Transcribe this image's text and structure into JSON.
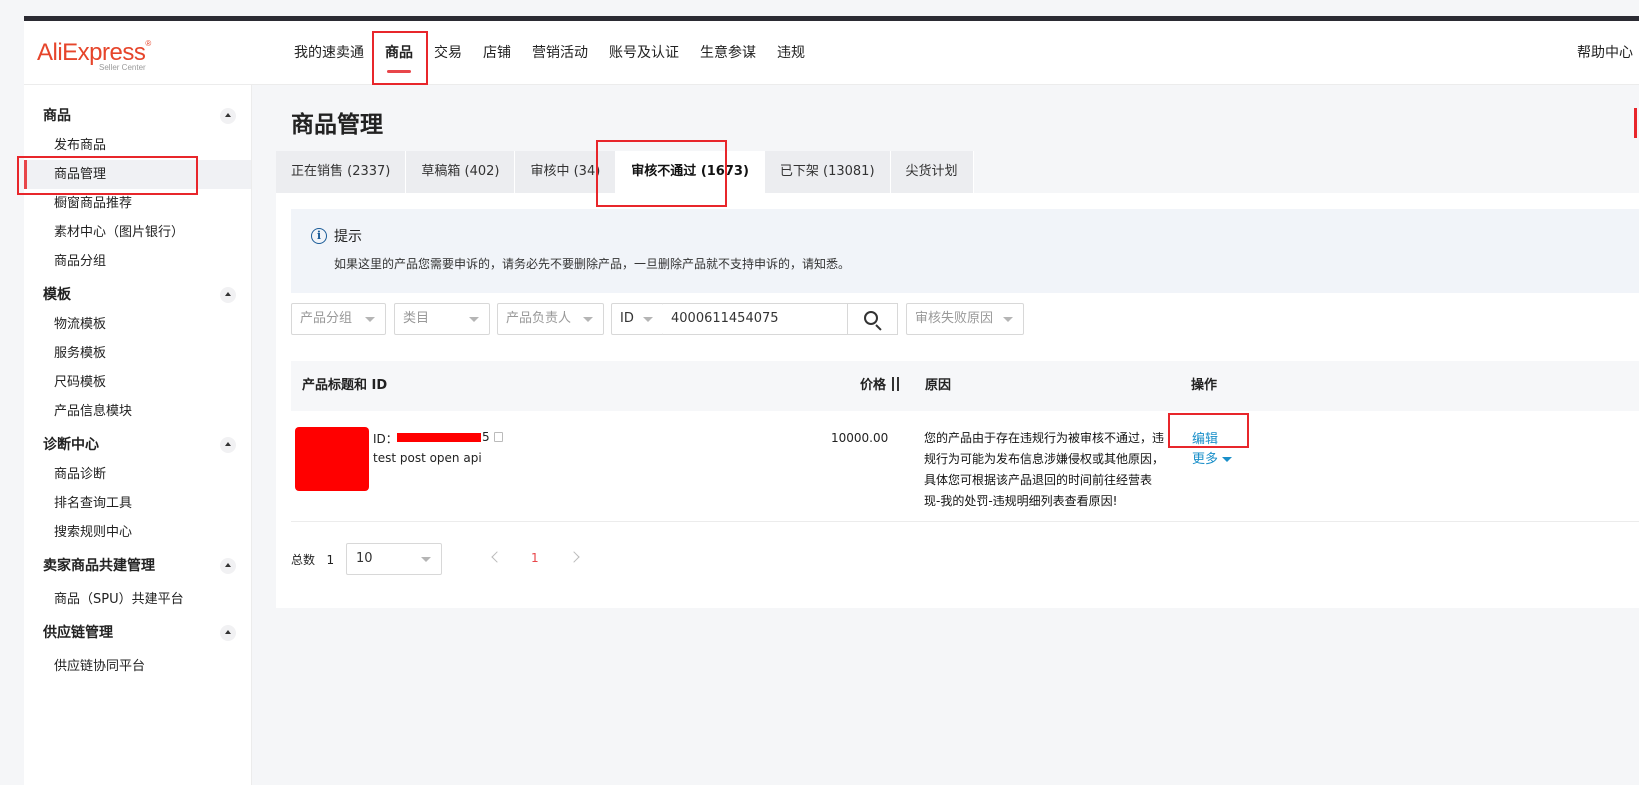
{
  "header": {
    "logo_text": "AliExpress",
    "logo_sub": "Seller Center",
    "nav": [
      "我的速卖通",
      "商品",
      "交易",
      "店铺",
      "营销活动",
      "账号及认证",
      "生意参谋",
      "违规"
    ],
    "help": "帮助中心"
  },
  "sidebar": {
    "groups": [
      {
        "title": "商品",
        "items": [
          "发布商品",
          "商品管理",
          "橱窗商品推荐",
          "素材中心（图片银行）",
          "商品分组"
        ]
      },
      {
        "title": "模板",
        "items": [
          "物流模板",
          "服务模板",
          "尺码模板",
          "产品信息模块"
        ]
      },
      {
        "title": "诊断中心",
        "items": [
          "商品诊断",
          "排名查询工具",
          "搜索规则中心"
        ]
      },
      {
        "title": "卖家商品共建管理",
        "items": [
          "商品（SPU）共建平台"
        ]
      },
      {
        "title": "供应链管理",
        "items": [
          "供应链协同平台"
        ]
      }
    ]
  },
  "page": {
    "title": "商品管理",
    "tabs": [
      "正在销售 (2337)",
      "草稿箱 (402)",
      "审核中 (34)",
      "审核不通过 (1673)",
      "已下架 (13081)",
      "尖货计划"
    ]
  },
  "notice": {
    "icon": "info-icon",
    "title": "提示",
    "text": "如果这里的产品您需要申诉的，请务必先不要删除产品，一旦删除产品就不支持申诉的，请知悉。"
  },
  "filters": {
    "group": "产品分组",
    "category": "类目",
    "owner": "产品负责人",
    "id_type": "ID",
    "id_value": "4000611454075",
    "fail_reason": "审核失败原因"
  },
  "table": {
    "headers": {
      "title": "产品标题和 ID",
      "price": "价格",
      "reason": "原因",
      "action": "操作"
    },
    "row": {
      "id_label": "ID：",
      "id_suffix": "5",
      "name": "test post open api",
      "price": "10000.00",
      "reason": "您的产品由于存在违规行为被审核不通过，违规行为可能为发布信息涉嫌侵权或其他原因，具体您可根据该产品退回的时间前往经营表现-我的处罚-违规明细列表查看原因!",
      "edit": "编辑",
      "more": "更多"
    }
  },
  "pagination": {
    "total_label": "总数",
    "total": "1",
    "page_size": "10",
    "current_page": "1"
  },
  "colors": {
    "accent": "#e8464a",
    "link": "#1a8fc9",
    "highlight": "#e8262b"
  }
}
